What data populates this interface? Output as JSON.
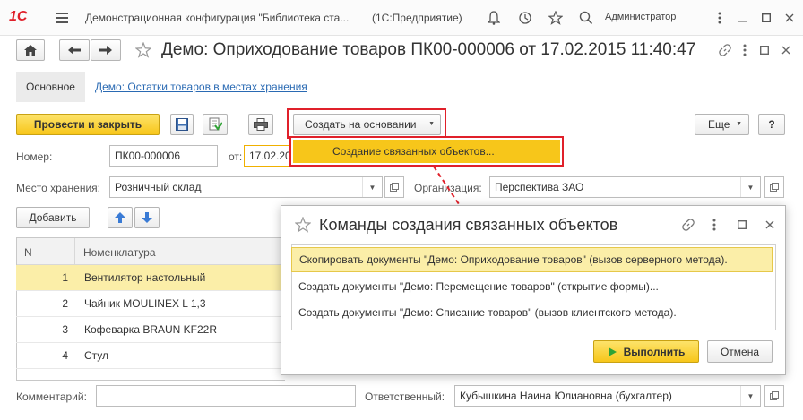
{
  "app": {
    "logo": "1С",
    "title": "Демонстрационная конфигурация \"Библиотека ста...",
    "platform": "(1С:Предприятие)",
    "user": "Администратор"
  },
  "doc": {
    "title": "Демо: Оприходование товаров ПК00-000006 от 17.02.2015 11:40:47"
  },
  "nav": {
    "main_tab": "Основное",
    "link": "Демо: Остатки товаров в местах хранения"
  },
  "toolbar": {
    "post_close": "Провести и закрыть",
    "create_based": "Создать на основании",
    "more": "Еще",
    "help": "?"
  },
  "popup": {
    "item": "Создание связанных объектов..."
  },
  "form": {
    "number_label": "Номер:",
    "number_value": "ПК00-000006",
    "date_label": "от:",
    "date_value": "17.02.20",
    "storage_label": "Место хранения:",
    "storage_value": "Розничный склад",
    "org_label": "Организация:",
    "org_value": "Перспектива ЗАО",
    "comment_label": "Комментарий:",
    "comment_value": "",
    "responsible_label": "Ответственный:",
    "responsible_value": "Кубышкина Наина Юлиановна (бухгалтер)"
  },
  "table": {
    "add_button": "Добавить",
    "columns": [
      "N",
      "Номенклатура"
    ],
    "rows": [
      {
        "n": "1",
        "name": "Вентилятор настольный"
      },
      {
        "n": "2",
        "name": "Чайник MOULINEX L 1,3"
      },
      {
        "n": "3",
        "name": "Кофеварка BRAUN KF22R"
      },
      {
        "n": "4",
        "name": "Стул"
      }
    ]
  },
  "dialog": {
    "title": "Команды создания связанных объектов",
    "commands": [
      "Скопировать документы \"Демо: Оприходование товаров\" (вызов серверного метода).",
      "Создать документы \"Демо: Перемещение товаров\" (открытие формы)...",
      "Создать документы \"Демо: Списание товаров\" (вызов клиентского метода)."
    ],
    "execute": "Выполнить",
    "cancel": "Отмена"
  },
  "colors": {
    "accent_yellow": "#f7c61a",
    "highlight_red": "#e0202a",
    "selection_row": "#fbeea8",
    "link_blue": "#2a6ab3"
  }
}
